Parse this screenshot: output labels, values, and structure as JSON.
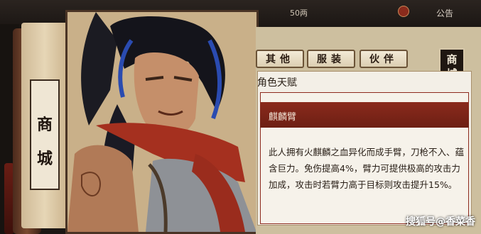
{
  "header": {
    "currency_value": "50两",
    "notice_label": "公告"
  },
  "scroll": {
    "char1": "商",
    "char2": "城"
  },
  "tabs": [
    {
      "label": "其他"
    },
    {
      "label": "服装"
    },
    {
      "label": "伙伴"
    }
  ],
  "shop_badge": {
    "line1": "商",
    "line2": "城"
  },
  "talent": {
    "section_title": "角色天赋",
    "name": "麒麟臂",
    "description": "此人拥有火麒麟之血异化而成手臂，刀枪不入、蕴含巨力。免伤提高4%，臂力可提供极高的攻击力加成，攻击时若臂力高于目标则攻击提升15%。"
  },
  "watermark": "搜狐号@香菜香"
}
